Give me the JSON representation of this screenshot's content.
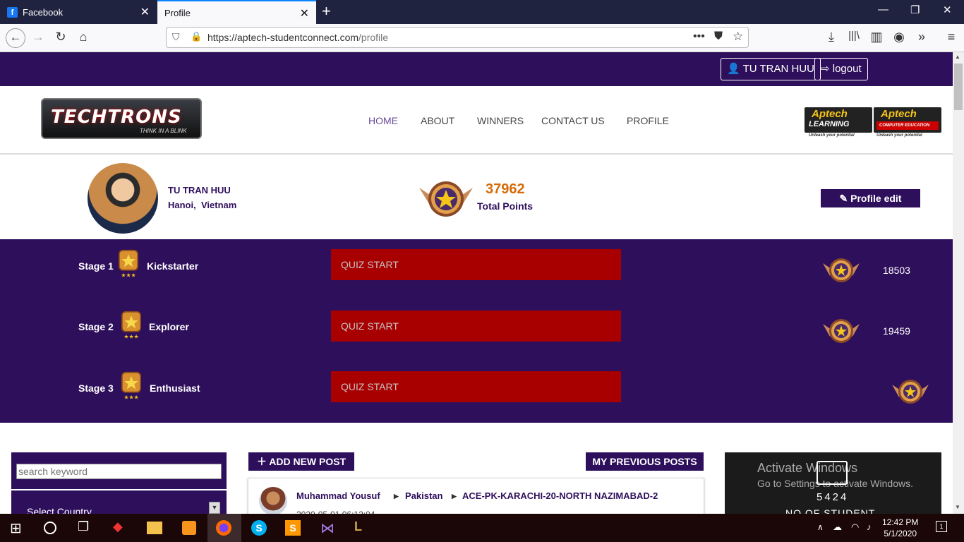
{
  "browser": {
    "tabs": [
      {
        "label": "Facebook"
      },
      {
        "label": "Profile"
      }
    ],
    "url_main": "https://aptech-studentconnect.com",
    "url_path": "/profile",
    "new_tab": "+"
  },
  "topbar": {
    "user": "TU TRAN HUU",
    "logout": "logout"
  },
  "header": {
    "logo_text": "TECHTRONS",
    "logo_tagline": "THINK IN A BLINK",
    "nav": [
      "HOME",
      "ABOUT",
      "WINNERS",
      "CONTACT US",
      "PROFILE"
    ],
    "partner1_a": "Aptech",
    "partner1_b": "LEARNING",
    "partner1_c": "Unleash your potential",
    "partner2_a": "Aptech",
    "partner2_b": "COMPUTER EDUCATION",
    "partner2_c": "Unleash your potential"
  },
  "profile": {
    "name": "TU TRAN HUU",
    "city": "Hanoi,",
    "country": "Vietnam",
    "points": "37962",
    "points_label": "Total Points",
    "edit_label": "Profile edit"
  },
  "stages": [
    {
      "stage": "Stage 1",
      "name": "Kickstarter",
      "quiz": "QUIZ START",
      "points": "18503"
    },
    {
      "stage": "Stage 2",
      "name": "Explorer",
      "quiz": "QUIZ START",
      "points": "19459"
    },
    {
      "stage": "Stage 3",
      "name": "Enthusiast",
      "quiz": "QUIZ START",
      "points": ""
    }
  ],
  "sidebar": {
    "search_placeholder": "search keyword",
    "country_select": "Select Country"
  },
  "posts": {
    "add_label": "ADD NEW POST",
    "previous_label": "MY PREVIOUS POSTS",
    "author": "Muhammad Yousuf",
    "country": "Pakistan",
    "group": "ACE-PK-KARACHI-20-NORTH NAZIMABAD-2",
    "date": "2020-05-01 06:12:04"
  },
  "ad": {
    "activate_title": "Activate Windows",
    "activate_sub": "Go to Settings to activate Windows.",
    "number": "5424",
    "label": "NO OF STUDENT"
  },
  "taskbar": {
    "time": "12:42 PM",
    "date": "5/1/2020",
    "notifications": "1"
  },
  "colors": {
    "brand_purple": "#2e0f5c",
    "quiz_red": "#a80000",
    "points_orange": "#d46b08"
  }
}
